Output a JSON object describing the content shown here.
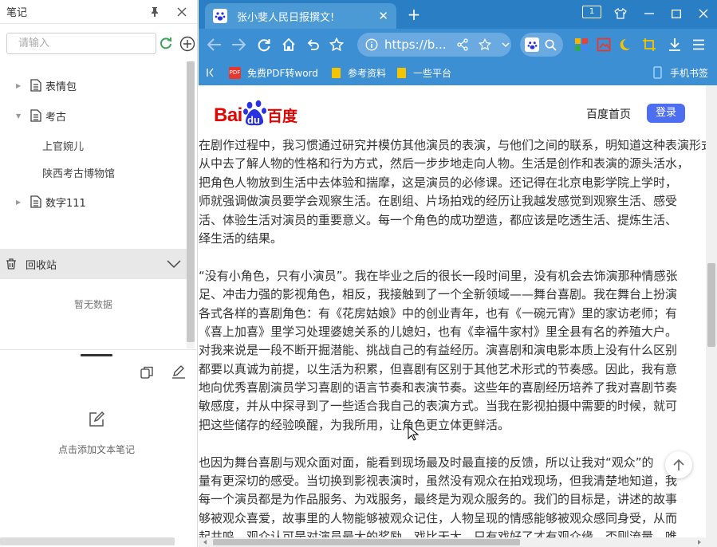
{
  "notes_panel": {
    "title": "笔记",
    "search_placeholder": "请输入",
    "tree": [
      {
        "label": "表情包",
        "expanded": false
      },
      {
        "label": "考古",
        "expanded": true,
        "children": [
          "上官婉儿",
          "陕西考古博物馆"
        ]
      },
      {
        "label": "数字111",
        "expanded": false
      }
    ],
    "trash_label": "回收站",
    "empty_text": "暂无数据",
    "add_text_note": "点击添加文本笔记"
  },
  "browser": {
    "tab_title": "张小斐人民日报撰文!",
    "tab_count": "1",
    "address_url": "https://b...",
    "bookmarks": [
      "免费PDF转word",
      "参考资料",
      "一些平台",
      "手机书签"
    ],
    "colors": {
      "chrome": "#2a7fc4",
      "toolbar": "#3d8fd3",
      "accent": "#4e6ef2",
      "baidu_red": "#e10602",
      "baidu_blue": "#2932e1"
    }
  },
  "page": {
    "logo_text_left": "Bai",
    "logo_text_paw": "du",
    "logo_text_right": "百度",
    "home_link": "百度首页",
    "login": "登录",
    "article_lines": [
      "在剧作过程中，我习惯通过研究并模仿其他演员的表演，与他们之间的联系，明知道这种表演形式不能照搬，",
      "从中去了解人物的性格和行为方式，然后一步步地走向人物。生活是创作和表演的源头活水，",
      "把角色人物放到生活中去体验和揣摩，这是演员的必修课。还记得在北京电影学院上学时，",
      "师就强调做演员要学会观察生活。在剧组、片场拍戏的经历让我越发感觉到观察生活、感受",
      "活、体验生活对演员的重要意义。每一个角色的成功塑造，都应该是吃透生活、提炼生活、",
      "绎生活的结果。",
      "",
      "“没有小角色，只有小演员”。我在毕业之后的很长一段时间里，没有机会去饰演那种情感张",
      "足、冲击力强的影视角色，相反，我接触到了一个全新领域——舞台喜剧。我在舞台上扮演",
      "各式各样的喜剧角色：有《花房姑娘》中的创业青年，也有《一碗元宵》里的家访老师；有",
      "《喜上加喜》里学习处理婆媳关系的儿媳妇，也有《幸福牛家村》里全县有名的养殖大户。",
      "对我来说是一段不断开掘潜能、挑战自己的有益经历。演喜剧和演电影本质上没有什么区别",
      "都要以真诚为前提，以生活为积累，但喜剧有区别于其他艺术形式的节奏感。因此，我有意",
      "地向优秀喜剧演员学习喜剧的语言节奏和表演节奏。这些年的喜剧经历培养了我对喜剧节奏",
      "敏感度，并从中探寻到了一些适合我自己的表演方式。当我在影视拍摄中需要的时候，就可",
      "把这些储存的经验唤醒，为我所用，让角色更立体更鲜活。",
      "",
      "也因为舞台喜剧与观众面对面，能看到现场最及时最直接的反馈，所以让我对“观众”的",
      "量有更深切的感受。当切换到影视表演时，虽然没有观众在拍戏现场，但我清楚地知道，我",
      "每一个演员都是为作品服务、为戏服务，最终是为观众服务的。我们的目标是，讲述的故事",
      "够被观众喜爱，故事里的人物能够被观众记住，人物呈现的情感能够被观众感同身受，从而",
      "起共鸣。观众认可是对演员最大的奖励，戏比天大，只有戏好了才有观众缘，否则流量，唯"
    ]
  }
}
